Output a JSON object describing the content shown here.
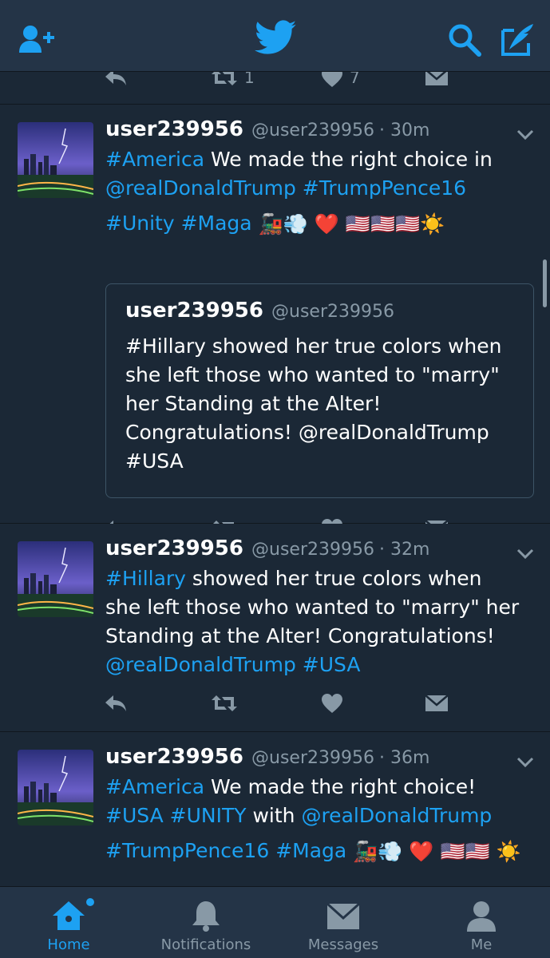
{
  "colors": {
    "accent": "#1da1f2",
    "background": "#1b2836",
    "bar": "#243447",
    "muted": "#8899a6"
  },
  "topbar": {
    "icons": [
      "add-user-icon",
      "twitter-bird-icon",
      "search-icon",
      "compose-icon"
    ]
  },
  "partial_actions": {
    "retweet_count": "1",
    "like_count": "7"
  },
  "tweets": [
    {
      "username": "user239956",
      "handle": "@user239956",
      "time": "· 30m",
      "lines": [
        {
          "tag": "#America",
          "rest": " We made the right choice in"
        },
        {
          "mention": "@realDonaldTrump",
          "tag": "#TrumpPence16"
        },
        {
          "tag1": "#Unity",
          "tag2": "#Maga"
        }
      ],
      "emojis": "🚂💨 ❤️ 🇺🇸🇺🇸🇺🇸☀️",
      "quote": {
        "username": "user239956",
        "handle": "@user239956",
        "lines": [
          "#Hillary showed her true colors when",
          "she left those who wanted to \"marry\"",
          "her Standing at the Alter!",
          "Congratulations! @realDonaldTrump",
          "#USA"
        ]
      }
    },
    {
      "username": "user239956",
      "handle": "@user239956",
      "time": "· 32m",
      "lines": [
        {
          "tag": "#Hillary",
          "rest": " showed her true colors when"
        },
        {
          "plain": "she left those who wanted to \"marry\" her"
        },
        {
          "plain": "Standing at the Alter! Congratulations!"
        },
        {
          "mention": "@realDonaldTrump",
          "tag": "#USA"
        }
      ]
    },
    {
      "username": "user239956",
      "handle": "@user239956",
      "time": "· 36m",
      "lines": [
        {
          "tag": "#America",
          "rest": " We made the right choice!"
        },
        {
          "tag1": "#USA",
          "tag2": "#UNITY",
          "with": " with ",
          "mention": "@realDonaldTrump"
        },
        {
          "tag1": "#TrumpPence16",
          "tag2": "#Maga"
        }
      ],
      "emojis": "🚂💨 ❤️ 🇺🇸🇺🇸 ☀️"
    }
  ],
  "tabbar": {
    "home": "Home",
    "notifications": "Notifications",
    "messages": "Messages",
    "me": "Me"
  }
}
